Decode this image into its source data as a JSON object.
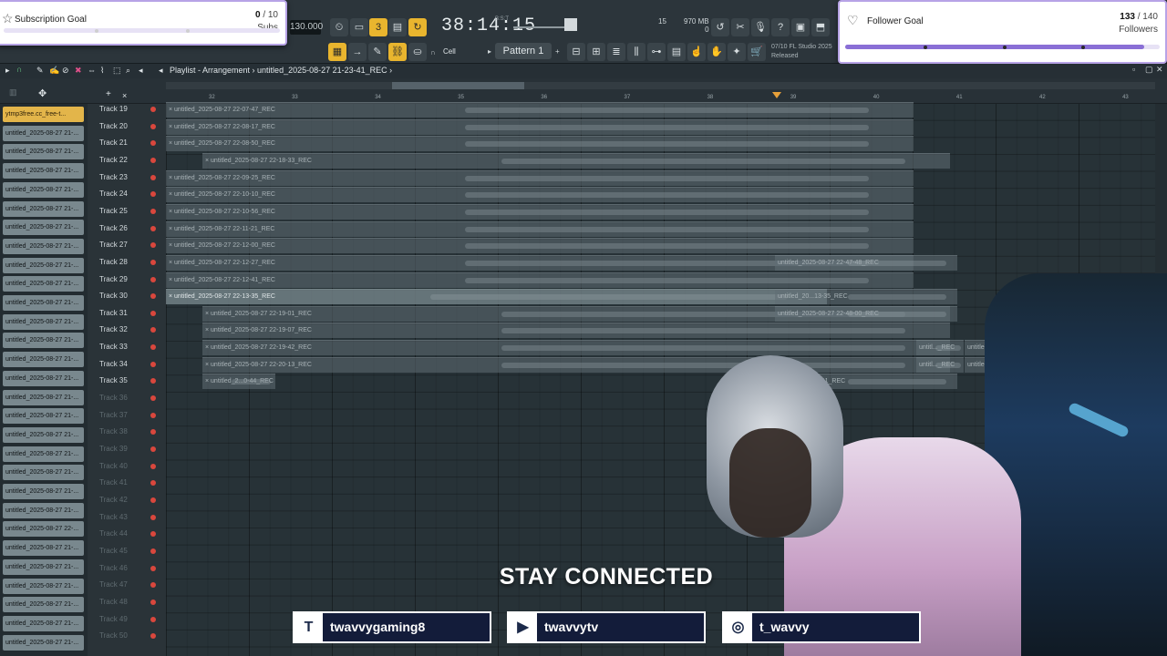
{
  "toolbar": {
    "bpm": "130.000",
    "time": "38:14:15",
    "bst": "B:S:T",
    "pattern": "Pattern 1",
    "snap": "Cell",
    "memory": "970 MB",
    "memory_sub": "0",
    "mini_counter": "15",
    "hint_line1": "07/10  FL Studio 2025",
    "hint_line2": "Released"
  },
  "subscription_goal": {
    "label": "Subscription Goal",
    "current": "0",
    "target": "/ 10",
    "unit": "Subs",
    "progress": 0.0
  },
  "follower_goal": {
    "label": "Follower Goal",
    "current": "133",
    "target": "/ 140",
    "unit": "Followers",
    "progress": 0.95
  },
  "playlist": {
    "title": "Playlist - Arrangement",
    "file": "untitled_2025-08-27 21-23-41_REC",
    "ruler_numbers": [
      "32",
      "33",
      "34",
      "35",
      "36",
      "37",
      "38",
      "39",
      "40",
      "41",
      "42",
      "43"
    ]
  },
  "picker": {
    "items": [
      {
        "label": "ytmp3free.cc_free-t...",
        "selected": true
      },
      {
        "label": "untitled_2025-08-27 21-..."
      },
      {
        "label": "untitled_2025-08-27 21-..."
      },
      {
        "label": "untitled_2025-08-27 21-..."
      },
      {
        "label": "untitled_2025-08-27 21-..."
      },
      {
        "label": "untitled_2025-08-27 21-..."
      },
      {
        "label": "untitled_2025-08-27 21-..."
      },
      {
        "label": "untitled_2025-08-27 21-..."
      },
      {
        "label": "untitled_2025-08-27 21-..."
      },
      {
        "label": "untitled_2025-08-27 21-..."
      },
      {
        "label": "untitled_2025-08-27 21-..."
      },
      {
        "label": "untitled_2025-08-27 21-..."
      },
      {
        "label": "untitled_2025-08-27 21-..."
      },
      {
        "label": "untitled_2025-08-27 21-..."
      },
      {
        "label": "untitled_2025-08-27 21-..."
      },
      {
        "label": "untitled_2025-08-27 21-..."
      },
      {
        "label": "untitled_2025-08-27 21-..."
      },
      {
        "label": "untitled_2025-08-27 21-..."
      },
      {
        "label": "untitled_2025-08-27 21-..."
      },
      {
        "label": "untitled_2025-08-27 21-..."
      },
      {
        "label": "untitled_2025-08-27 21-..."
      },
      {
        "label": "untitled_2025-08-27 21-..."
      },
      {
        "label": "untitled_2025-08-27 22-..."
      },
      {
        "label": "untitled_2025-08-27 21-..."
      },
      {
        "label": "untitled_2025-08-27 21-..."
      },
      {
        "label": "untitled_2025-08-27 21-..."
      },
      {
        "label": "untitled_2025-08-27 21-..."
      },
      {
        "label": "untitled_2025-08-27 21-..."
      },
      {
        "label": "untitled_2025-08-27 21-..."
      }
    ]
  },
  "tracks": [
    {
      "name": "Track 19",
      "active": true
    },
    {
      "name": "Track 20",
      "active": true
    },
    {
      "name": "Track 21",
      "active": true
    },
    {
      "name": "Track 22",
      "active": true
    },
    {
      "name": "Track 23",
      "active": true
    },
    {
      "name": "Track 24",
      "active": true
    },
    {
      "name": "Track 25",
      "active": true
    },
    {
      "name": "Track 26",
      "active": true
    },
    {
      "name": "Track 27",
      "active": true
    },
    {
      "name": "Track 28",
      "active": true
    },
    {
      "name": "Track 29",
      "active": true
    },
    {
      "name": "Track 30",
      "active": true
    },
    {
      "name": "Track 31",
      "active": true
    },
    {
      "name": "Track 32",
      "active": true
    },
    {
      "name": "Track 33",
      "active": true
    },
    {
      "name": "Track 34",
      "active": true
    },
    {
      "name": "Track 35",
      "active": true
    },
    {
      "name": "Track 36",
      "active": false
    },
    {
      "name": "Track 37",
      "active": false
    },
    {
      "name": "Track 38",
      "active": false
    },
    {
      "name": "Track 39",
      "active": false
    },
    {
      "name": "Track 40",
      "active": false
    },
    {
      "name": "Track 41",
      "active": false
    },
    {
      "name": "Track 42",
      "active": false
    },
    {
      "name": "Track 43",
      "active": false
    },
    {
      "name": "Track 44",
      "active": false
    },
    {
      "name": "Track 45",
      "active": false
    },
    {
      "name": "Track 46",
      "active": false
    },
    {
      "name": "Track 47",
      "active": false
    },
    {
      "name": "Track 48",
      "active": false
    },
    {
      "name": "Track 49",
      "active": false
    },
    {
      "name": "Track 50",
      "active": false
    }
  ],
  "clips": [
    {
      "row": 0,
      "label": "untitled_2025-08-27 22-07-47_REC"
    },
    {
      "row": 1,
      "label": "untitled_2025-08-27 22-08-17_REC"
    },
    {
      "row": 2,
      "label": "untitled_2025-08-27 22-08-50_REC"
    },
    {
      "row": 3,
      "label": "untitled_2025-08-27 22-18-33_REC",
      "indent": true
    },
    {
      "row": 4,
      "label": "untitled_2025-08-27 22-09-25_REC"
    },
    {
      "row": 5,
      "label": "untitled_2025-08-27 22-10-10_REC"
    },
    {
      "row": 6,
      "label": "untitled_2025-08-27 22-10-56_REC"
    },
    {
      "row": 7,
      "label": "untitled_2025-08-27 22-11-21_REC"
    },
    {
      "row": 8,
      "label": "untitled_2025-08-27 22-12-00_REC"
    },
    {
      "row": 9,
      "label": "untitled_2025-08-27 22-12-27_REC"
    },
    {
      "row": 10,
      "label": "untitled_2025-08-27 22-12-41_REC"
    },
    {
      "row": 11,
      "label": "untitled_2025-08-27 22-13-35_REC",
      "highlight": true
    },
    {
      "row": 12,
      "label": "untitled_2025-08-27 22-19-01_REC",
      "indent": true
    },
    {
      "row": 13,
      "label": "untitled_2025-08-27 22-19-07_REC",
      "indent": true
    },
    {
      "row": 14,
      "label": "untitled_2025-08-27 22-19-42_REC",
      "indent": true
    },
    {
      "row": 15,
      "label": "untitled_2025-08-27 22-20-13_REC",
      "indent": true
    },
    {
      "row": 16,
      "label": "untitled_2...0-44_REC",
      "indent": true,
      "short": true
    }
  ],
  "side_clips": [
    {
      "row": 9,
      "label": "untitled_2025-08-27 22-47-48_REC"
    },
    {
      "row": 11,
      "label": "untitled_20...13-35_REC"
    },
    {
      "row": 12,
      "label": "untitled_2025-08-27 22-48-00_REC"
    },
    {
      "row": 16,
      "label": "...-08-27 22-48-11_REC"
    }
  ],
  "far_clips": [
    {
      "row": 14,
      "label": "untitl..._REC",
      "label2": "untitled_2025-08-27 22-1"
    },
    {
      "row": 15,
      "label": "untitl..._REC",
      "label2": "untitled_2025-08-27 22-"
    }
  ],
  "overlay": {
    "stay_connected": "STAY CONNECTED",
    "socials": [
      {
        "icon": "twitch-icon",
        "glyph": "T",
        "handle": "twavvygaming8"
      },
      {
        "icon": "youtube-icon",
        "glyph": "▶",
        "handle": "twavvytv"
      },
      {
        "icon": "instagram-icon",
        "glyph": "◎",
        "handle": "t_wavvy"
      }
    ]
  },
  "colors": {
    "accent": "#e9b52e",
    "goal_border": "#b7a3e6",
    "record_dot": "#d9473d",
    "social_bg": "#131c3a"
  }
}
